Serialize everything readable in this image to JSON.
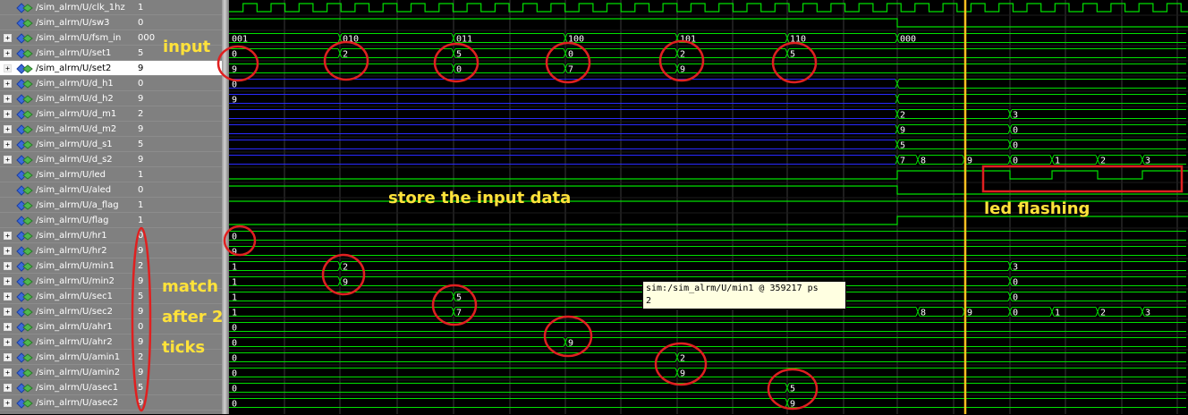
{
  "signals": [
    {
      "path": "/sim_alrm/U/clk_1hz",
      "value": "1",
      "expandable": false,
      "icon": "wire-signal-icon"
    },
    {
      "path": "/sim_alrm/U/sw3",
      "value": "0",
      "expandable": false,
      "icon": "wire-signal-icon"
    },
    {
      "path": "/sim_alrm/U/fsm_in",
      "value": "000",
      "expandable": true,
      "icon": "bus-signal-icon"
    },
    {
      "path": "/sim_alrm/U/set1",
      "value": "5",
      "expandable": true,
      "icon": "bus-signal-icon"
    },
    {
      "path": "/sim_alrm/U/set2",
      "value": "9",
      "expandable": true,
      "icon": "bus-signal-icon",
      "selected": true
    },
    {
      "path": "/sim_alrm/U/d_h1",
      "value": "0",
      "expandable": true,
      "icon": "bus-signal-icon"
    },
    {
      "path": "/sim_alrm/U/d_h2",
      "value": "9",
      "expandable": true,
      "icon": "bus-signal-icon"
    },
    {
      "path": "/sim_alrm/U/d_m1",
      "value": "2",
      "expandable": true,
      "icon": "bus-signal-icon"
    },
    {
      "path": "/sim_alrm/U/d_m2",
      "value": "9",
      "expandable": true,
      "icon": "bus-signal-icon"
    },
    {
      "path": "/sim_alrm/U/d_s1",
      "value": "5",
      "expandable": true,
      "icon": "bus-signal-icon"
    },
    {
      "path": "/sim_alrm/U/d_s2",
      "value": "9",
      "expandable": true,
      "icon": "bus-signal-icon"
    },
    {
      "path": "/sim_alrm/U/led",
      "value": "1",
      "expandable": false,
      "icon": "wire-signal-icon"
    },
    {
      "path": "/sim_alrm/U/aled",
      "value": "0",
      "expandable": false,
      "icon": "wire-signal-icon"
    },
    {
      "path": "/sim_alrm/U/a_flag",
      "value": "1",
      "expandable": false,
      "icon": "wire-signal-icon"
    },
    {
      "path": "/sim_alrm/U/flag",
      "value": "1",
      "expandable": false,
      "icon": "wire-signal-icon"
    },
    {
      "path": "/sim_alrm/U/hr1",
      "value": "0",
      "expandable": true,
      "icon": "bus-signal-icon"
    },
    {
      "path": "/sim_alrm/U/hr2",
      "value": "9",
      "expandable": true,
      "icon": "bus-signal-icon"
    },
    {
      "path": "/sim_alrm/U/min1",
      "value": "2",
      "expandable": true,
      "icon": "bus-signal-icon"
    },
    {
      "path": "/sim_alrm/U/min2",
      "value": "9",
      "expandable": true,
      "icon": "bus-signal-icon"
    },
    {
      "path": "/sim_alrm/U/sec1",
      "value": "5",
      "expandable": true,
      "icon": "bus-signal-icon"
    },
    {
      "path": "/sim_alrm/U/sec2",
      "value": "9",
      "expandable": true,
      "icon": "bus-signal-icon"
    },
    {
      "path": "/sim_alrm/U/ahr1",
      "value": "0",
      "expandable": true,
      "icon": "bus-signal-icon"
    },
    {
      "path": "/sim_alrm/U/ahr2",
      "value": "9",
      "expandable": true,
      "icon": "bus-signal-icon"
    },
    {
      "path": "/sim_alrm/U/amin1",
      "value": "2",
      "expandable": true,
      "icon": "bus-signal-icon"
    },
    {
      "path": "/sim_alrm/U/amin2",
      "value": "9",
      "expandable": true,
      "icon": "bus-signal-icon"
    },
    {
      "path": "/sim_alrm/U/asec1",
      "value": "5",
      "expandable": true,
      "icon": "bus-signal-icon"
    },
    {
      "path": "/sim_alrm/U/asec2",
      "value": "9",
      "expandable": true,
      "icon": "bus-signal-icon"
    }
  ],
  "bus_labels": {
    "fsm_in": [
      "001",
      "010",
      "011",
      "100",
      "101",
      "110",
      "000"
    ],
    "set1": [
      "0",
      "2",
      "5",
      "0",
      "2",
      "5"
    ],
    "set2": [
      "9",
      "0",
      "7",
      "9",
      "9"
    ],
    "d_h1": [
      "0"
    ],
    "d_h2": [
      "9"
    ],
    "d_m1": [
      "2",
      "3"
    ],
    "d_m2": [
      "9",
      "0"
    ],
    "d_s1": [
      "5",
      "0"
    ],
    "d_s2": [
      "7",
      "8",
      "9",
      "0",
      "1",
      "2",
      "3"
    ],
    "hr1": [
      "0"
    ],
    "hr2": [
      "9"
    ],
    "min1": [
      "1",
      "2",
      "3"
    ],
    "min2": [
      "1",
      "9",
      "0"
    ],
    "sec1": [
      "1",
      "5",
      "0"
    ],
    "sec2": [
      "1",
      "7",
      "8",
      "9",
      "0",
      "1",
      "2",
      "3"
    ],
    "ahr1": [
      "0"
    ],
    "ahr2": [
      "0",
      "9"
    ],
    "amin1": [
      "0",
      "2"
    ],
    "amin2": [
      "0",
      "9"
    ],
    "asec1": [
      "0",
      "5"
    ],
    "asec2": [
      "0",
      "9"
    ]
  },
  "annotations": {
    "input": "input",
    "store": "store the input data",
    "led": "led flashing",
    "match1": "match",
    "match2": "after 2",
    "match3": "ticks"
  },
  "tooltip": {
    "line1": "sim:/sim_alrm/U/min1 @ 359217 ps",
    "line2": "2"
  },
  "colors": {
    "wave_green": "#00e000",
    "bus_blue": "#2a2aff",
    "cursor": "#ffc020",
    "annotation": "#ffe23a",
    "marker_red": "#e02020"
  }
}
